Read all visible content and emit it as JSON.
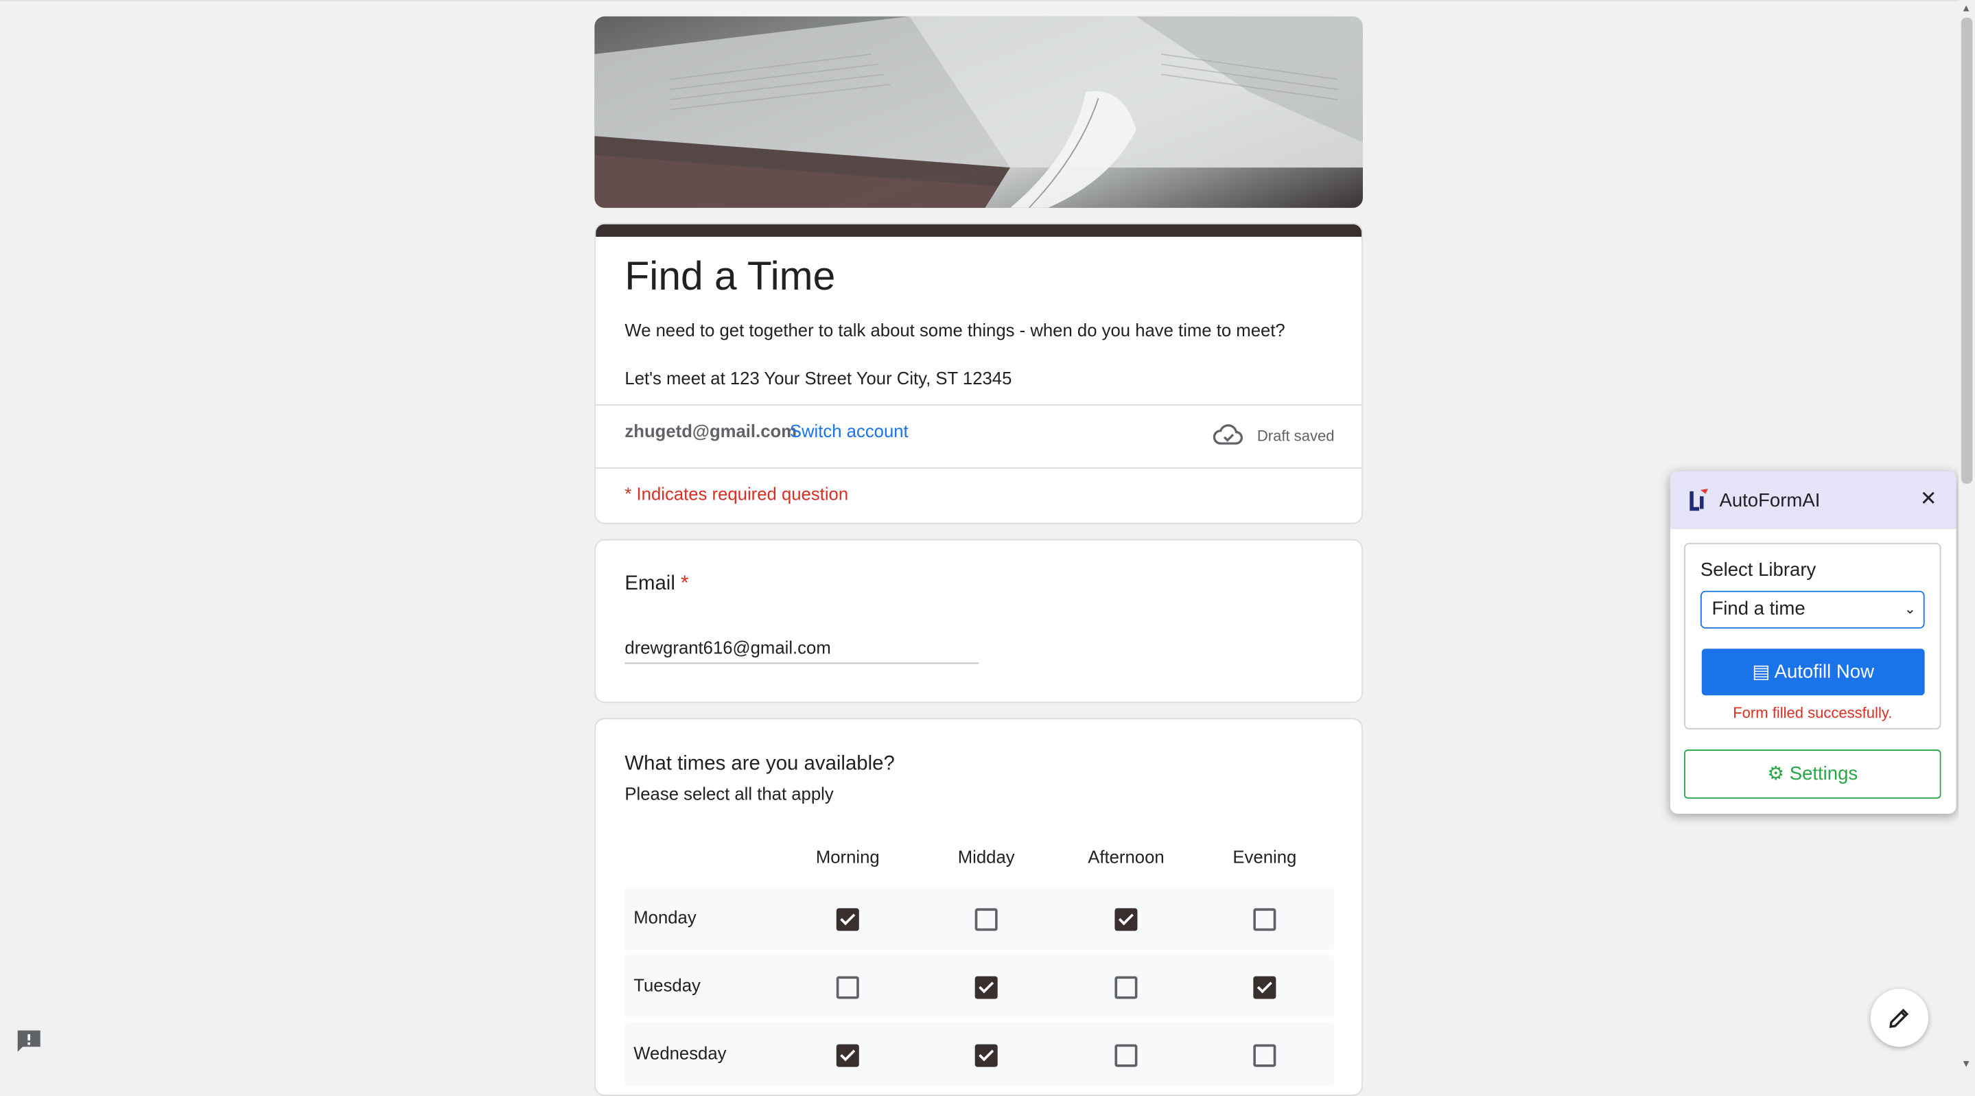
{
  "form": {
    "title": "Find a Time",
    "description": "We need to get together to talk about some things - when do you have time to meet?",
    "description2": "Let's meet at 123 Your Street Your City, ST 12345",
    "account_email": "zhugetd@gmail.com",
    "switch_account": "Switch account",
    "draft_status": "Draft saved",
    "required_note": "* Indicates required question",
    "accent_color": "#3a2f2f"
  },
  "email_question": {
    "label": "Email",
    "required_star": "*",
    "value": "drewgrant616@gmail.com"
  },
  "availability": {
    "question": "What times are you available?",
    "subtitle": "Please select all that apply",
    "columns": [
      "Morning",
      "Midday",
      "Afternoon",
      "Evening"
    ],
    "rows": [
      {
        "day": "Monday",
        "checked": [
          true,
          false,
          true,
          false
        ]
      },
      {
        "day": "Tuesday",
        "checked": [
          false,
          true,
          false,
          true
        ]
      },
      {
        "day": "Wednesday",
        "checked": [
          true,
          true,
          false,
          false
        ]
      }
    ]
  },
  "autoformai": {
    "title": "AutoFormAI",
    "close": "✕",
    "select_label": "Select Library",
    "selected_library": "Find a time",
    "autofill_button": "Autofill Now",
    "status": "Form filled successfully.",
    "settings_button": "Settings",
    "colors": {
      "primary": "#1a73e8",
      "success": "#28a745",
      "error": "#d93025",
      "header_bg": "#e4e3f8"
    }
  },
  "icons": {
    "cloud": "cloud-check-icon",
    "feedback": "feedback-icon",
    "edit": "pencil-icon",
    "close": "close-icon"
  }
}
